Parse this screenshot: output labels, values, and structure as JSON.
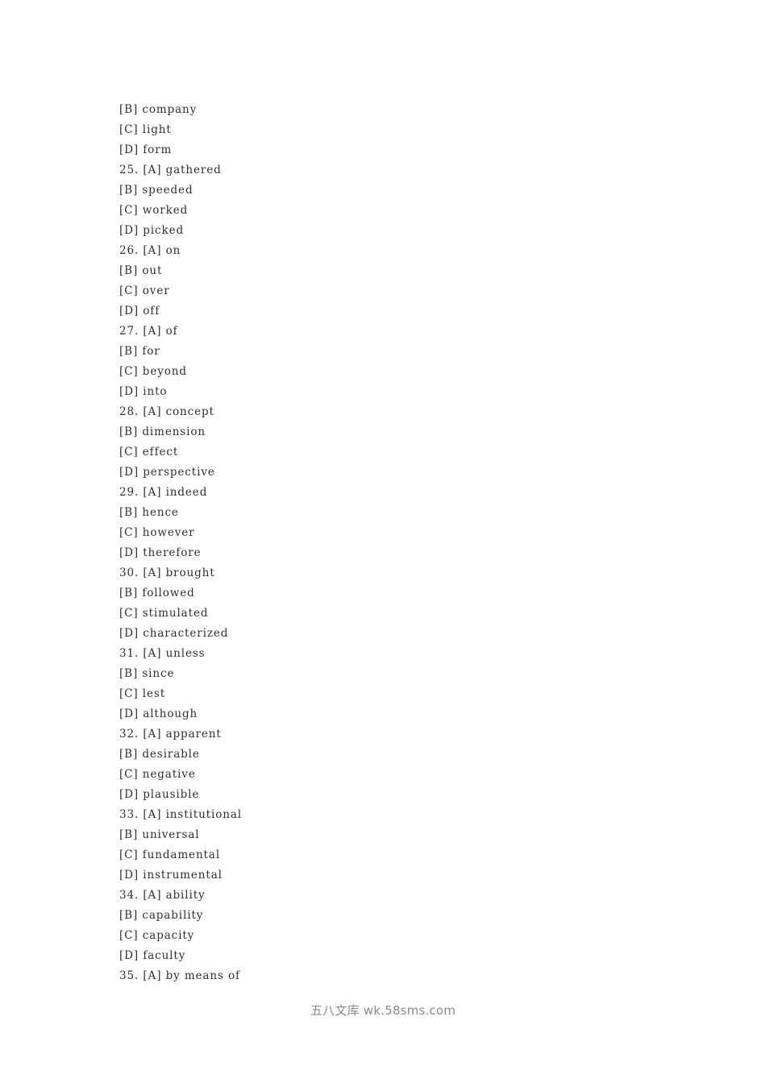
{
  "document": {
    "type": "exam-answer-options-list",
    "background_color": "#ffffff",
    "text_color": "#2f2f2f",
    "lines": [
      {
        "num": "",
        "tag": "[B]",
        "word": "company"
      },
      {
        "num": "",
        "tag": "[C]",
        "word": "light"
      },
      {
        "num": "",
        "tag": "[D]",
        "word": "form"
      },
      {
        "num": "25.",
        "tag": "[A]",
        "word": "gathered"
      },
      {
        "num": "",
        "tag": "[B]",
        "word": "speeded"
      },
      {
        "num": "",
        "tag": "[C]",
        "word": "worked"
      },
      {
        "num": "",
        "tag": "[D]",
        "word": "picked"
      },
      {
        "num": "26.",
        "tag": "[A]",
        "word": "on"
      },
      {
        "num": "",
        "tag": "[B]",
        "word": "out"
      },
      {
        "num": "",
        "tag": "[C]",
        "word": "over"
      },
      {
        "num": "",
        "tag": "[D]",
        "word": "off"
      },
      {
        "num": "27.",
        "tag": "[A]",
        "word": "of"
      },
      {
        "num": "",
        "tag": "[B]",
        "word": "for"
      },
      {
        "num": "",
        "tag": "[C]",
        "word": "beyond"
      },
      {
        "num": "",
        "tag": "[D]",
        "word": "into"
      },
      {
        "num": "28.",
        "tag": "[A]",
        "word": "concept"
      },
      {
        "num": "",
        "tag": "[B]",
        "word": "dimension"
      },
      {
        "num": "",
        "tag": "[C]",
        "word": "effect"
      },
      {
        "num": "",
        "tag": "[D]",
        "word": "perspective"
      },
      {
        "num": "29.",
        "tag": "[A]",
        "word": "indeed"
      },
      {
        "num": "",
        "tag": "[B]",
        "word": "hence"
      },
      {
        "num": "",
        "tag": "[C]",
        "word": "however"
      },
      {
        "num": "",
        "tag": "[D]",
        "word": "therefore"
      },
      {
        "num": "30.",
        "tag": "[A]",
        "word": "brought"
      },
      {
        "num": "",
        "tag": "[B]",
        "word": "followed"
      },
      {
        "num": "",
        "tag": "[C]",
        "word": "stimulated"
      },
      {
        "num": "",
        "tag": "[D]",
        "word": "characterized"
      },
      {
        "num": "31.",
        "tag": "[A]",
        "word": "unless"
      },
      {
        "num": "",
        "tag": "[B]",
        "word": "since"
      },
      {
        "num": "",
        "tag": "[C]",
        "word": "lest"
      },
      {
        "num": "",
        "tag": "[D]",
        "word": "although"
      },
      {
        "num": "32.",
        "tag": "[A]",
        "word": "apparent"
      },
      {
        "num": "",
        "tag": "[B]",
        "word": "desirable"
      },
      {
        "num": "",
        "tag": "[C]",
        "word": "negative"
      },
      {
        "num": "",
        "tag": "[D]",
        "word": "plausible"
      },
      {
        "num": "33.",
        "tag": "[A]",
        "word": "institutional"
      },
      {
        "num": "",
        "tag": "[B]",
        "word": "universal"
      },
      {
        "num": "",
        "tag": "[C]",
        "word": "fundamental"
      },
      {
        "num": "",
        "tag": "[D]",
        "word": "instrumental"
      },
      {
        "num": "34.",
        "tag": "[A]",
        "word": "ability"
      },
      {
        "num": "",
        "tag": "[B]",
        "word": "capability"
      },
      {
        "num": "",
        "tag": "[C]",
        "word": "capacity"
      },
      {
        "num": "",
        "tag": "[D]",
        "word": "faculty"
      },
      {
        "num": "35.",
        "tag": "[A]",
        "word": "by means of"
      }
    ]
  },
  "footer": {
    "watermark": "五八文库 wk.58sms.com"
  }
}
